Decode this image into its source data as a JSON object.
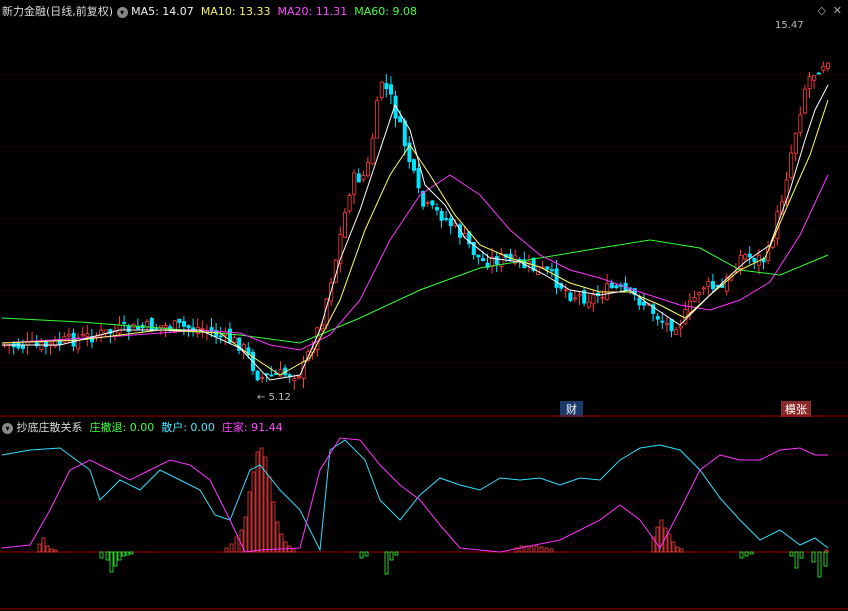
{
  "main": {
    "title": "新力金融(日线,前复权)",
    "ma5": "MA5: 14.07",
    "ma10": "MA10: 13.33",
    "ma20": "MA20: 11.31",
    "ma60": "MA60: 9.08",
    "high_label": "15.47",
    "low_label": "5.12",
    "badge_cai": "财",
    "badge_lz": "模张"
  },
  "sub": {
    "title": "抄底庄散关系",
    "zhuang_che": "庄撤退: 0.00",
    "sanhu": "散户: 0.00",
    "zhuangjia": "庄家: 91.44"
  },
  "colors": {
    "up": "#ff3b3b",
    "down": "#00e5ff",
    "ma5": "#ffffff",
    "ma10": "#ffff66",
    "ma20": "#ff33ff",
    "ma60": "#33ff33",
    "grid": "#8b0000"
  }
}
